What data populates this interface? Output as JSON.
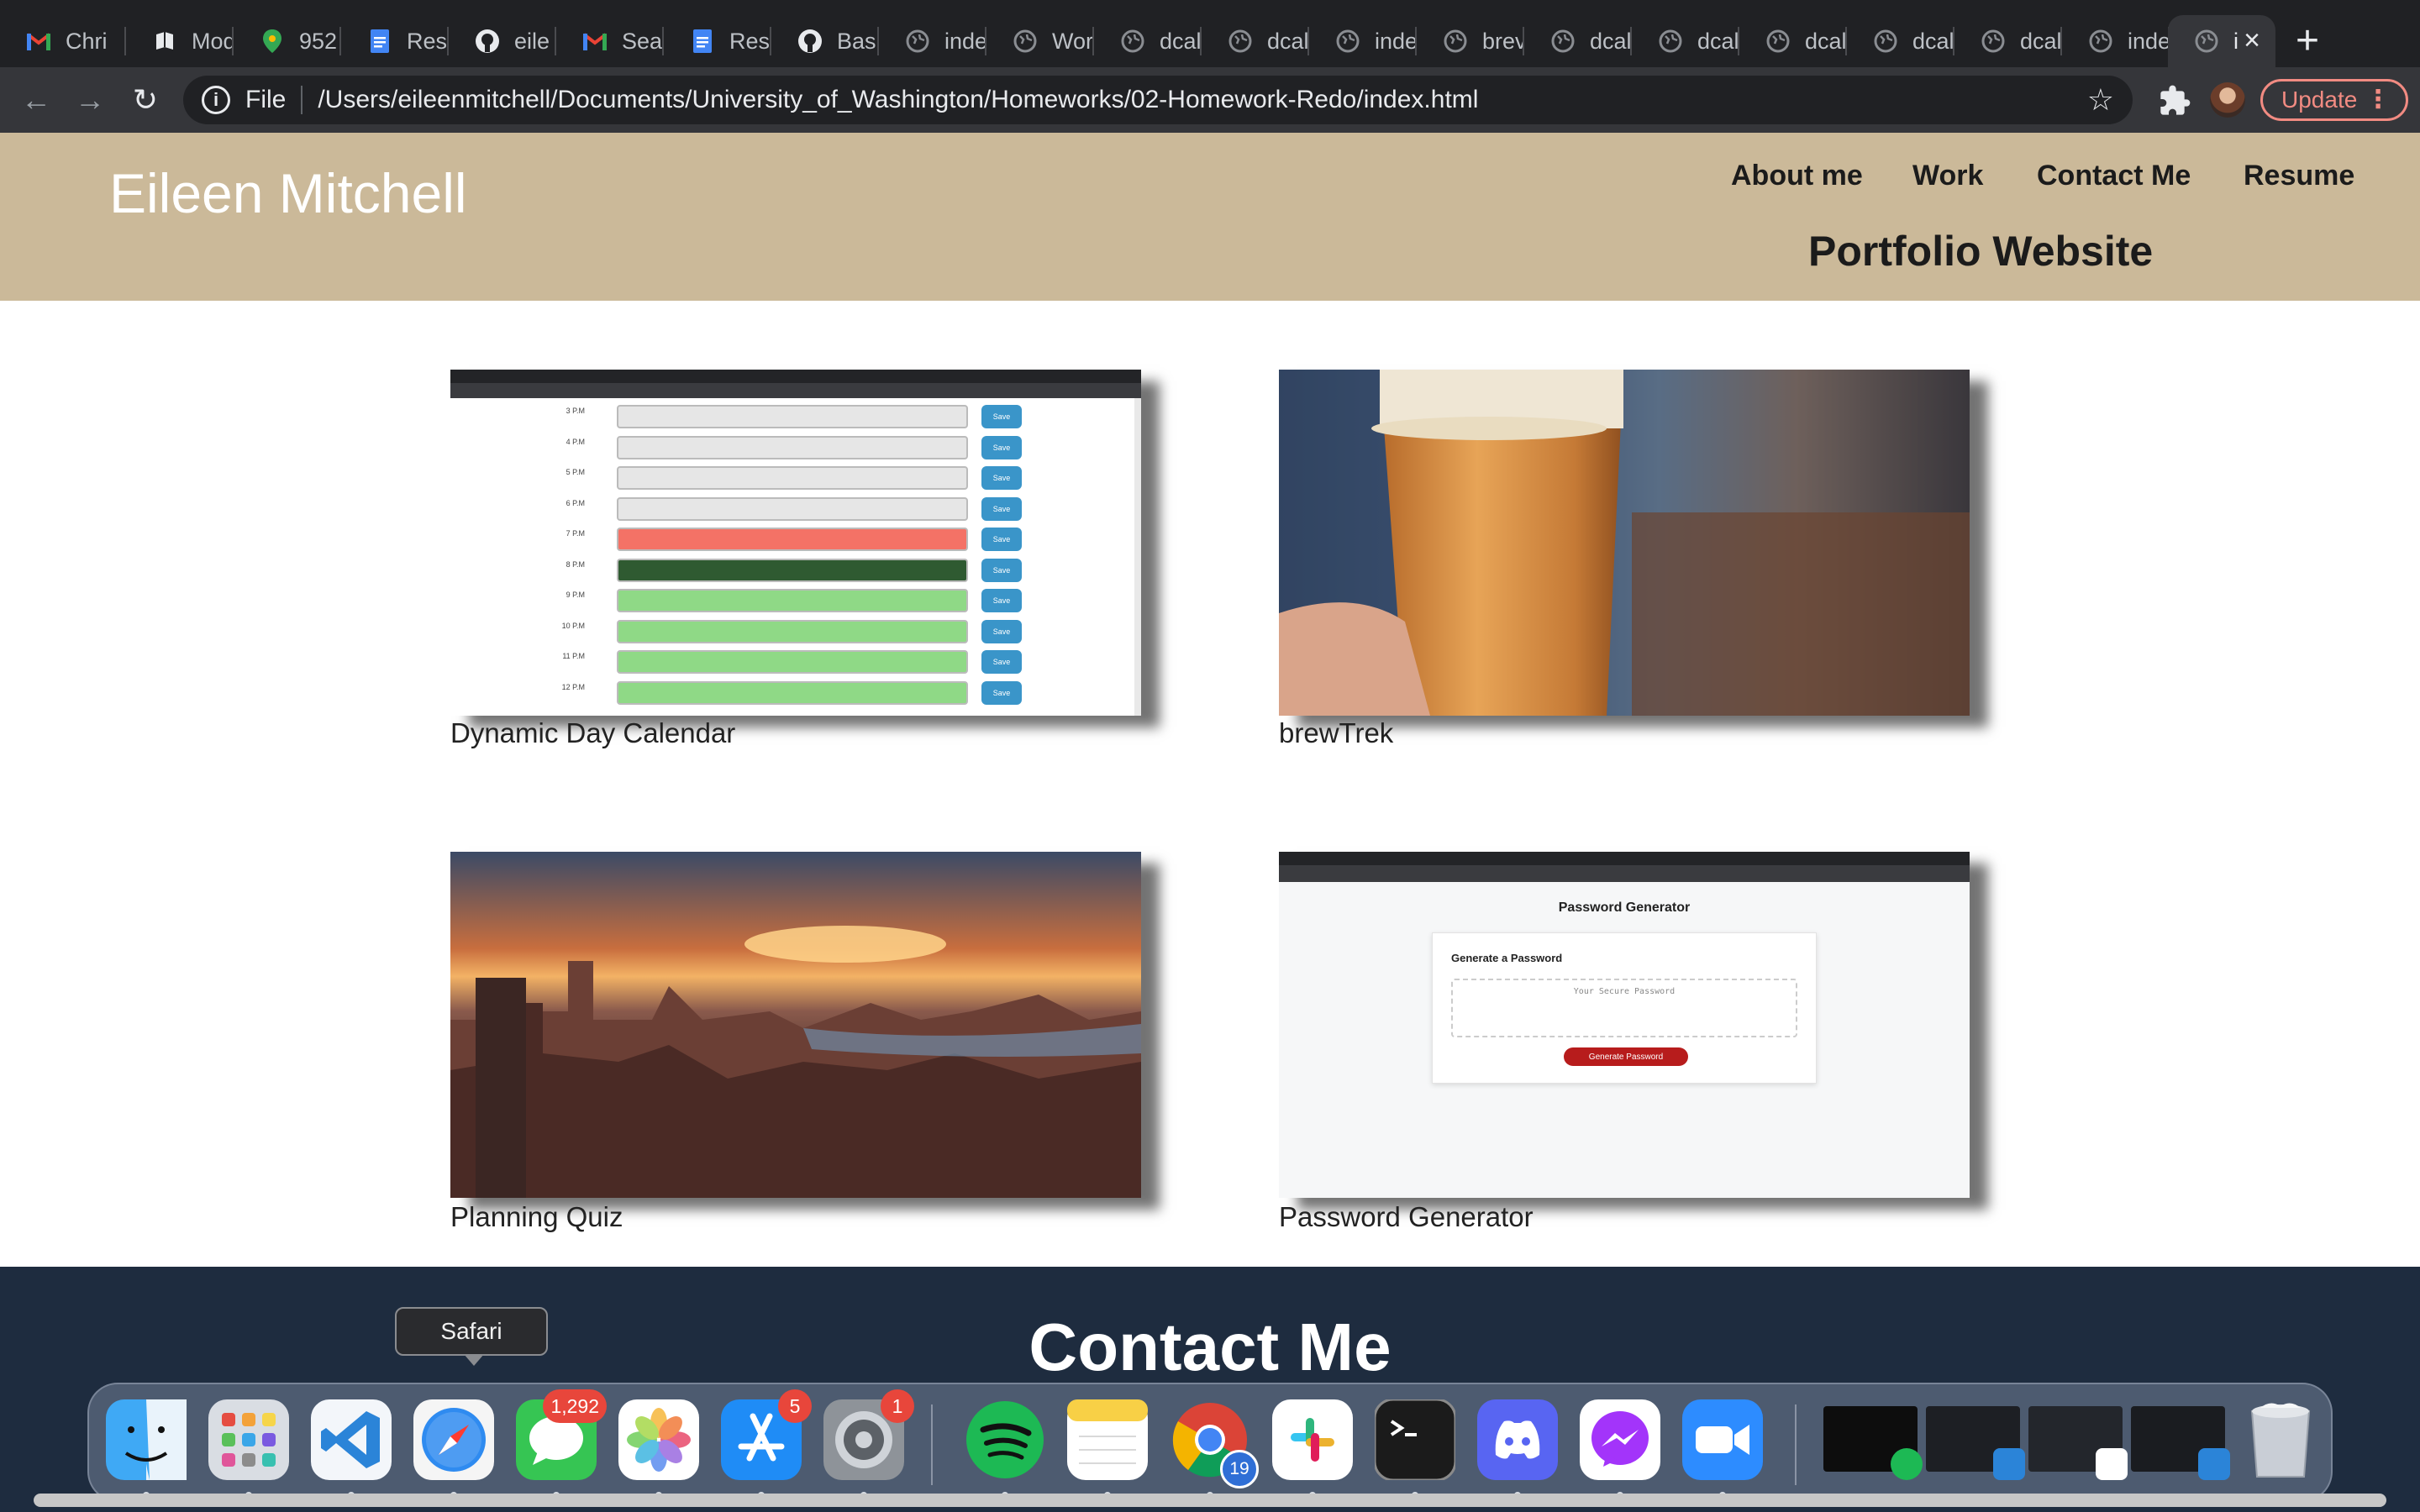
{
  "browser": {
    "tabs": [
      {
        "title": "Chri",
        "icon": "gmail-icon"
      },
      {
        "title": "Mod",
        "icon": "book-icon"
      },
      {
        "title": "952",
        "icon": "maps-pin-icon"
      },
      {
        "title": "Resu",
        "icon": "docs-icon"
      },
      {
        "title": "eile",
        "icon": "github-icon"
      },
      {
        "title": "Sear",
        "icon": "gmail-icon"
      },
      {
        "title": "Resu",
        "icon": "docs-icon"
      },
      {
        "title": "Basi",
        "icon": "github-icon"
      },
      {
        "title": "inde",
        "icon": "globe-icon"
      },
      {
        "title": "Wor",
        "icon": "globe-icon"
      },
      {
        "title": "dcal",
        "icon": "globe-icon"
      },
      {
        "title": "dcal",
        "icon": "globe-icon"
      },
      {
        "title": "inde",
        "icon": "globe-icon"
      },
      {
        "title": "brev",
        "icon": "globe-icon"
      },
      {
        "title": "dcal",
        "icon": "globe-icon"
      },
      {
        "title": "dcal",
        "icon": "globe-icon"
      },
      {
        "title": "dcal",
        "icon": "globe-icon"
      },
      {
        "title": "dcal",
        "icon": "globe-icon"
      },
      {
        "title": "dcal",
        "icon": "globe-icon"
      },
      {
        "title": "inde",
        "icon": "globe-icon"
      },
      {
        "title": "i",
        "icon": "globe-icon",
        "active": true
      }
    ],
    "new_tab_glyph": "+",
    "scheme_label": "File",
    "url": "/Users/eileenmitchell/Documents/University_of_Washington/Homeworks/02-Homework-Redo/index.html",
    "update_label": "Update",
    "accent_color": "#f28b82"
  },
  "site": {
    "name": "Eileen Mitchell",
    "subtitle": "Portfolio Website",
    "nav": [
      "About me",
      "Work",
      "Contact Me",
      "Resume"
    ],
    "header_color": "#cbb999",
    "projects": [
      {
        "caption": "Dynamic Day Calendar",
        "thumb": "calendar-screenshot"
      },
      {
        "caption": "brewTrek",
        "thumb": "beer-photo"
      },
      {
        "caption": "Planning Quiz",
        "thumb": "city-photo"
      },
      {
        "caption": "Password Generator",
        "thumb": "password-screenshot"
      }
    ],
    "calendar_hours": [
      "3 P.M",
      "4 P.M",
      "5 P.M",
      "6 P.M",
      "7 P.M",
      "8 P.M",
      "9 P.M",
      "10 P.M",
      "11 P.M",
      "12 P.M"
    ],
    "calendar_states": [
      "past",
      "past",
      "past",
      "past",
      "present",
      "future-dark",
      "future",
      "future",
      "future",
      "future"
    ],
    "calendar_save_label": "Save",
    "password_thumb": {
      "title": "Password Generator",
      "card_heading": "Generate a Password",
      "placeholder": "Your Secure Password",
      "button": "Generate Password"
    },
    "contact_title": "Contact Me",
    "contact_bg": "#1e2c3f"
  },
  "dock": {
    "tooltip": "Safari",
    "apps": [
      {
        "name": "Finder",
        "icon": "finder-icon"
      },
      {
        "name": "Launchpad",
        "icon": "launchpad-icon"
      },
      {
        "name": "Visual Studio Code",
        "icon": "vscode-icon"
      },
      {
        "name": "Safari",
        "icon": "safari-icon"
      },
      {
        "name": "Messages",
        "icon": "messages-icon",
        "badge": "1,292"
      },
      {
        "name": "Photos",
        "icon": "photos-icon"
      },
      {
        "name": "App Store",
        "icon": "app-store-icon",
        "badge": "5"
      },
      {
        "name": "System Preferences",
        "icon": "system-preferences-icon",
        "badge": "1"
      },
      {
        "name": "Spotify",
        "icon": "spotify-icon"
      },
      {
        "name": "Notes",
        "icon": "notes-icon"
      },
      {
        "name": "Google Chrome",
        "icon": "chrome-icon",
        "badge": "19"
      },
      {
        "name": "Slack",
        "icon": "slack-icon"
      },
      {
        "name": "Terminal",
        "icon": "terminal-icon"
      },
      {
        "name": "Discord",
        "icon": "discord-icon"
      },
      {
        "name": "Messenger",
        "icon": "messenger-icon"
      },
      {
        "name": "Zoom",
        "icon": "zoom-icon"
      }
    ],
    "trash_icon": "trash-icon"
  }
}
